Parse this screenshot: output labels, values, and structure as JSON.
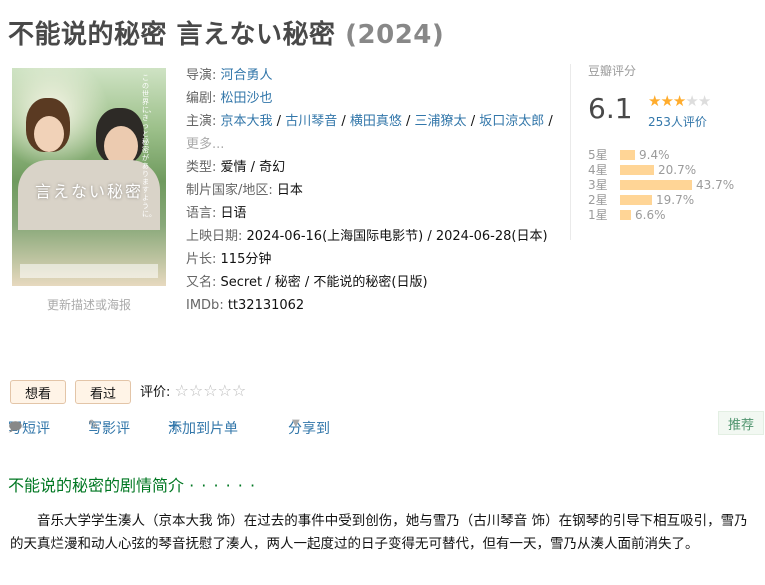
{
  "title": {
    "main": "不能说的秘密 言えない秘密",
    "year": "(2024)"
  },
  "poster": {
    "title": "言えない秘密",
    "vertical_text": "この世界に、きっと秘密がありますように。",
    "update_link": "更新描述或海报"
  },
  "info": {
    "director": {
      "label": "导演",
      "value": "河合勇人"
    },
    "writer": {
      "label": "编剧",
      "value": "松田沙也"
    },
    "cast": {
      "label": "主演",
      "names": [
        "京本大我",
        "古川琴音",
        "横田真悠",
        "三浦獠太",
        "坂口涼太郎"
      ],
      "more": "更多..."
    },
    "genre": {
      "label": "类型",
      "value": "爱情 / 奇幻"
    },
    "country": {
      "label": "制片国家/地区",
      "value": "日本"
    },
    "language": {
      "label": "语言",
      "value": "日语"
    },
    "release": {
      "label": "上映日期",
      "value": "2024-06-16(上海国际电影节) / 2024-06-28(日本)"
    },
    "runtime": {
      "label": "片长",
      "value": "115分钟"
    },
    "aka": {
      "label": "又名",
      "value": "Secret / 秘密 / 不能说的秘密(日版)"
    },
    "imdb": {
      "label": "IMDb",
      "value": "tt32131062"
    }
  },
  "rating": {
    "label": "豆瓣评分",
    "score": "6.1",
    "stars_filled": 3,
    "stars_total": 5,
    "votes": "253人评价",
    "distribution": [
      {
        "label": "5星",
        "pct": "9.4%",
        "value": 9.4
      },
      {
        "label": "4星",
        "pct": "20.7%",
        "value": 20.7
      },
      {
        "label": "3星",
        "pct": "43.7%",
        "value": 43.7
      },
      {
        "label": "2星",
        "pct": "19.7%",
        "value": 19.7
      },
      {
        "label": "1星",
        "pct": "6.6%",
        "value": 6.6
      }
    ]
  },
  "buttons": {
    "wish": "想看",
    "seen": "看过"
  },
  "my_rating": {
    "label": "评价:"
  },
  "actions": {
    "short_review": "写短评",
    "review": "写影评",
    "add_list": "添加到片单",
    "share": "分享到",
    "recommend": "推荐"
  },
  "summary": {
    "title": "不能说的秘密的剧情简介",
    "dots": "· · · · · ·",
    "text": "音乐大学学生湊人（京本大我 饰）在过去的事件中受到创伤，她与雪乃（古川琴音 饰）在钢琴的引导下相互吸引，雪乃的天真烂漫和动人心弦的琴音抚慰了湊人，两人一起度过的日子变得无可替代，但有一天，雪乃从湊人面前消失了。"
  }
}
